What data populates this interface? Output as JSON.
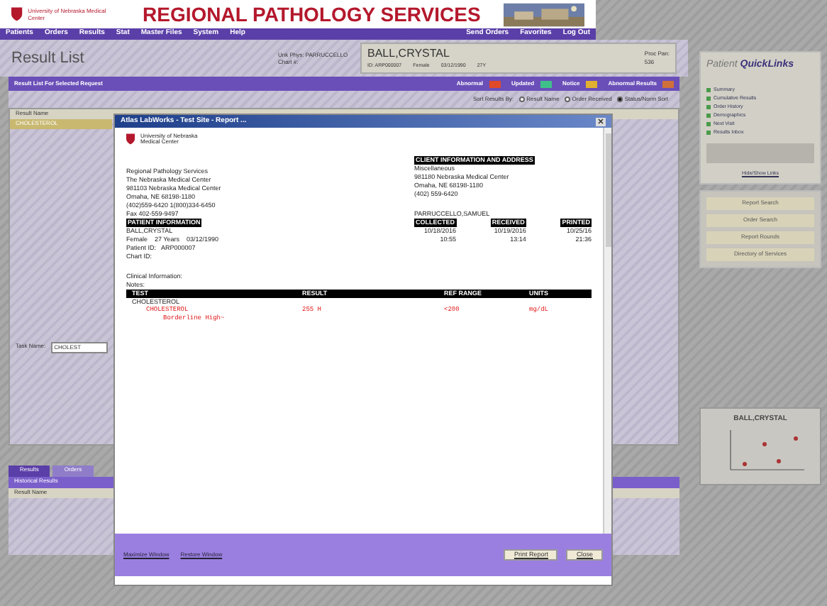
{
  "header": {
    "org": "University of Nebraska Medical Center",
    "title": "REGIONAL PATHOLOGY SERVICES"
  },
  "nav": {
    "left": [
      "Patients",
      "Orders",
      "Results",
      "Stat",
      "Master Files",
      "System",
      "Help"
    ],
    "right": [
      "Send Orders",
      "Favorites",
      "Log Out"
    ]
  },
  "page_title": "Result List",
  "patient": {
    "physician": "Unk Phys: PARRUCCELLO",
    "chart": "Chart #:",
    "name": "BALL,CRYSTAL",
    "id": "ID: ARP000007",
    "sex": "Female",
    "dob": "03/12/1990",
    "age": "27Y",
    "proc": "Proc Pan:",
    "proc_value": "536"
  },
  "result_panel": {
    "title": "Result List For Selected Request",
    "legend": [
      {
        "label": "Abnormal",
        "color": "#e04a2a"
      },
      {
        "label": "Updated",
        "color": "#3fbf8a"
      },
      {
        "label": "Notice",
        "color": "#e0b030"
      },
      {
        "label": "Abnormal Results",
        "color": "#d0703a"
      }
    ],
    "sort_label": "Sort Results By:",
    "sort_options": [
      {
        "label": "Result Name",
        "selected": false
      },
      {
        "label": "Order Received",
        "selected": false
      },
      {
        "label": "Status/Norm Sort",
        "selected": true
      }
    ],
    "column": "Result Name",
    "rows": [
      {
        "name": "CHOLESTEROL",
        "selected": true
      }
    ]
  },
  "task": {
    "label": "Task Name:",
    "value": "CHOLEST"
  },
  "bottom_tabs": [
    {
      "label": "Results",
      "selected": true
    },
    {
      "label": "Orders",
      "selected": false
    }
  ],
  "historical": {
    "title": "Historical Results",
    "column": "Result Name"
  },
  "quicklinks": {
    "title_a": "Patient",
    "title_b": "QuickLinks",
    "links": [
      "Summary",
      "Cumulative Results",
      "Order History",
      "Demographics",
      "Next Visit",
      "Results Inbox"
    ],
    "footer_link": "Hide/Show Links",
    "buttons": [
      "Report Search",
      "Order Search",
      "Report Rounds",
      "Directory of Services"
    ]
  },
  "trend_chart": {
    "title": "BALL,CRYSTAL"
  },
  "dialog": {
    "title": "Atlas LabWorks - Test Site - Report ...",
    "logo_text": [
      "University of Nebraska",
      "Medical Center"
    ],
    "lab": [
      "Regional Pathology Services",
      "The Nebraska Medical Center",
      "981103 Nebraska Medical Center",
      "Omaha, NE 68198-1180",
      "(402)559-6420 1(800)334-6450",
      "Fax 402-559-9497"
    ],
    "patient_heading": "PATIENT INFORMATION",
    "patient_lines": [
      "BALL,CRYSTAL",
      "Female    27 Years    03/12/1990",
      "Patient ID:   ARP000007",
      "Chart ID:"
    ],
    "client_heading": "CLIENT INFORMATION AND ADDRESS",
    "client_lines": [
      "Miscellaneous",
      "981180 Nebraska Medical Center",
      "Omaha, NE 68198-1180",
      "(402) 559-6420"
    ],
    "physician": "PARRUCCELLO,SAMUEL",
    "dates": [
      {
        "heading": "COLLECTED",
        "date": "10/18/2016",
        "time": "10:55"
      },
      {
        "heading": "RECEIVED",
        "date": "10/19/2016",
        "time": "13:14"
      },
      {
        "heading": "PRINTED",
        "date": "10/25/16",
        "time": "21:36"
      }
    ],
    "clinical": "Clinical Information:",
    "notes": "Notes:",
    "columns": [
      "TEST",
      "RESULT",
      "REF RANGE",
      "UNITS"
    ],
    "group": "CHOLESTEROL",
    "results": [
      {
        "test": "CHOLESTEROL",
        "result": "255 H",
        "range": "<200",
        "units": "mg/dL",
        "abnormal": true
      }
    ],
    "comment": "Borderline High~",
    "links": [
      "Maximize Window",
      "Restore Window"
    ],
    "buttons": [
      "Print Report",
      "Close"
    ]
  }
}
